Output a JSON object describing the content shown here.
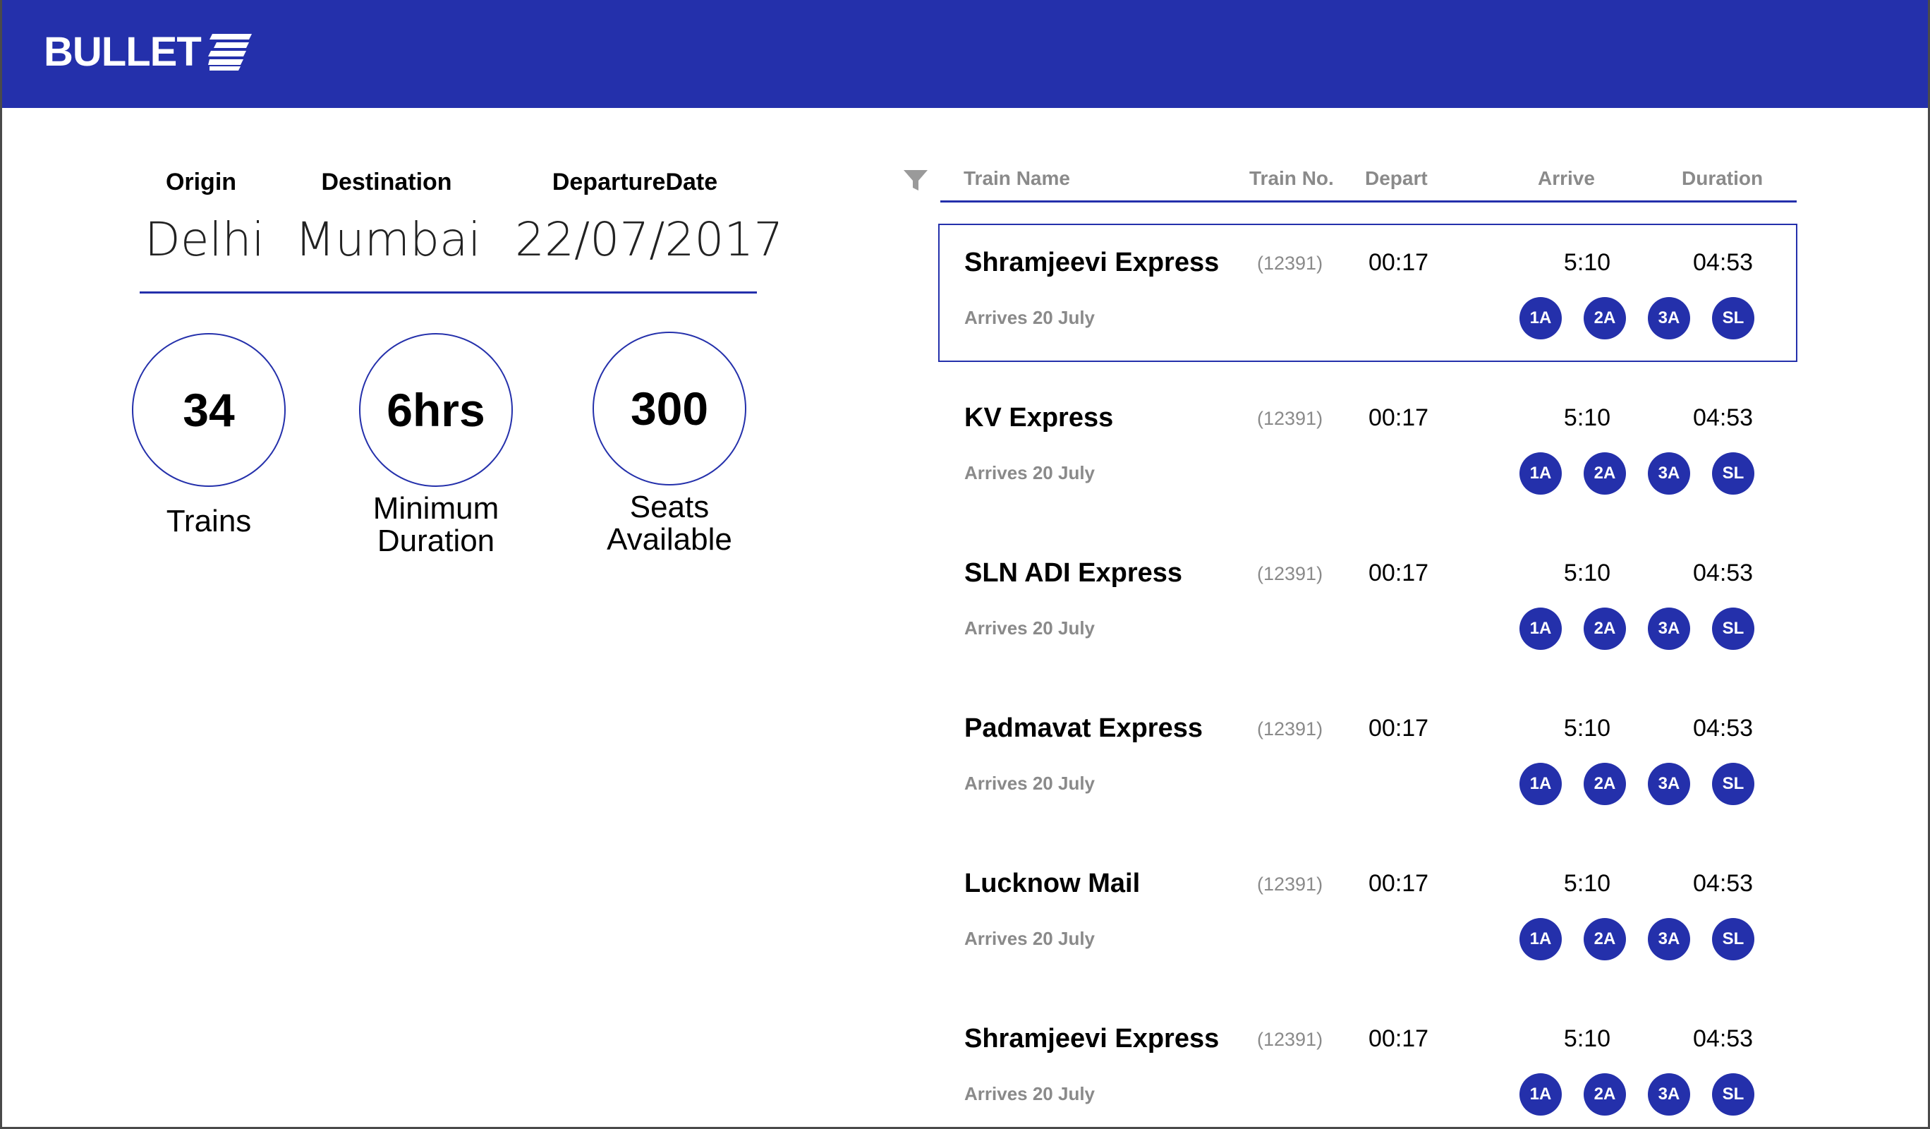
{
  "brand": {
    "name": "BULLET",
    "color": "#2430ab"
  },
  "search": {
    "origin_label": "Origin",
    "origin_value": "Delhi",
    "destination_label": "Destination",
    "destination_value": "Mumbai",
    "date_label": "DepartureDate",
    "date_value": "22/07/2017"
  },
  "stats": [
    {
      "value": "34",
      "label_line1": "Trains",
      "label_line2": ""
    },
    {
      "value": "6hrs",
      "label_line1": "Minimum",
      "label_line2": "Duration"
    },
    {
      "value": "300",
      "label_line1": "Seats",
      "label_line2": "Available"
    }
  ],
  "table": {
    "filter_icon": "filter-icon",
    "columns": [
      "Train Name",
      "Train No.",
      "Depart",
      "Arrive",
      "Duration"
    ],
    "rows": [
      {
        "name": "Shramjeevi Express",
        "number": "(12391)",
        "depart": "00:17",
        "arrive": "5:10",
        "duration": "04:53",
        "arrives_text": "Arrives 20 July",
        "classes": [
          "1A",
          "2A",
          "3A",
          "SL"
        ],
        "selected": true
      },
      {
        "name": "KV Express",
        "number": "(12391)",
        "depart": "00:17",
        "arrive": "5:10",
        "duration": "04:53",
        "arrives_text": "Arrives 20 July",
        "classes": [
          "1A",
          "2A",
          "3A",
          "SL"
        ],
        "selected": false
      },
      {
        "name": "SLN ADI Express",
        "number": "(12391)",
        "depart": "00:17",
        "arrive": "5:10",
        "duration": "04:53",
        "arrives_text": "Arrives 20 July",
        "classes": [
          "1A",
          "2A",
          "3A",
          "SL"
        ],
        "selected": false
      },
      {
        "name": "Padmavat Express",
        "number": "(12391)",
        "depart": "00:17",
        "arrive": "5:10",
        "duration": "04:53",
        "arrives_text": "Arrives 20 July",
        "classes": [
          "1A",
          "2A",
          "3A",
          "SL"
        ],
        "selected": false
      },
      {
        "name": "Lucknow Mail",
        "number": "(12391)",
        "depart": "00:17",
        "arrive": "5:10",
        "duration": "04:53",
        "arrives_text": "Arrives 20 July",
        "classes": [
          "1A",
          "2A",
          "3A",
          "SL"
        ],
        "selected": false
      },
      {
        "name": "Shramjeevi Express",
        "number": "(12391)",
        "depart": "00:17",
        "arrive": "5:10",
        "duration": "04:53",
        "arrives_text": "Arrives 20 July",
        "classes": [
          "1A",
          "2A",
          "3A",
          "SL"
        ],
        "selected": false
      }
    ]
  }
}
